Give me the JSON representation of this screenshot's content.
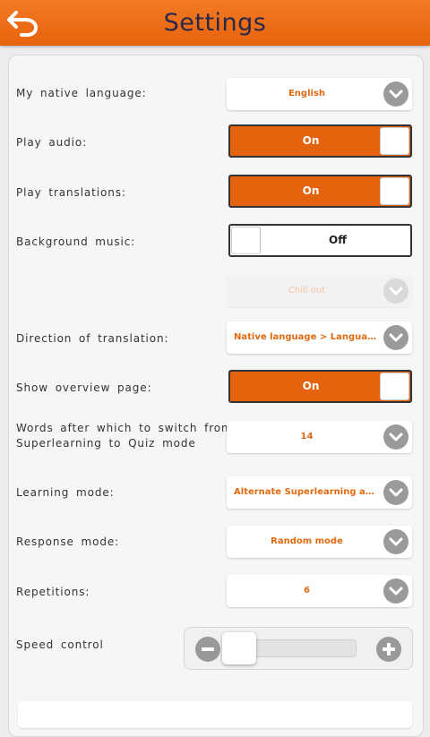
{
  "header": {
    "title": "Settings",
    "back_icon": "back-arrow-icon"
  },
  "colors": {
    "accent": "#e4640e",
    "header_top": "#f27b24",
    "title_text": "#2a2848"
  },
  "settings": {
    "native_language": {
      "label": "My native language:",
      "value": "English"
    },
    "play_audio": {
      "label": "Play audio:",
      "state": "On"
    },
    "play_translations": {
      "label": "Play translations:",
      "state": "On"
    },
    "background_music": {
      "label": "Background music:",
      "state": "Off"
    },
    "music_track": {
      "value": "Chill out"
    },
    "direction": {
      "label": "Direction of translation:",
      "value": "Native language > Language..."
    },
    "overview": {
      "label": "Show overview page:",
      "state": "On"
    },
    "switch_words": {
      "label_line1": "Words after which to switch from",
      "label_line2": "Superlearning to Quiz mode",
      "value": "14"
    },
    "learning_mode": {
      "label": "Learning mode:",
      "value": "Alternate Superlearning and..."
    },
    "response_mode": {
      "label": "Response mode:",
      "value": "Random mode"
    },
    "repetitions": {
      "label": "Repetitions:",
      "value": "6"
    },
    "speed": {
      "label": "Speed control",
      "level_fraction": 0.0
    }
  }
}
